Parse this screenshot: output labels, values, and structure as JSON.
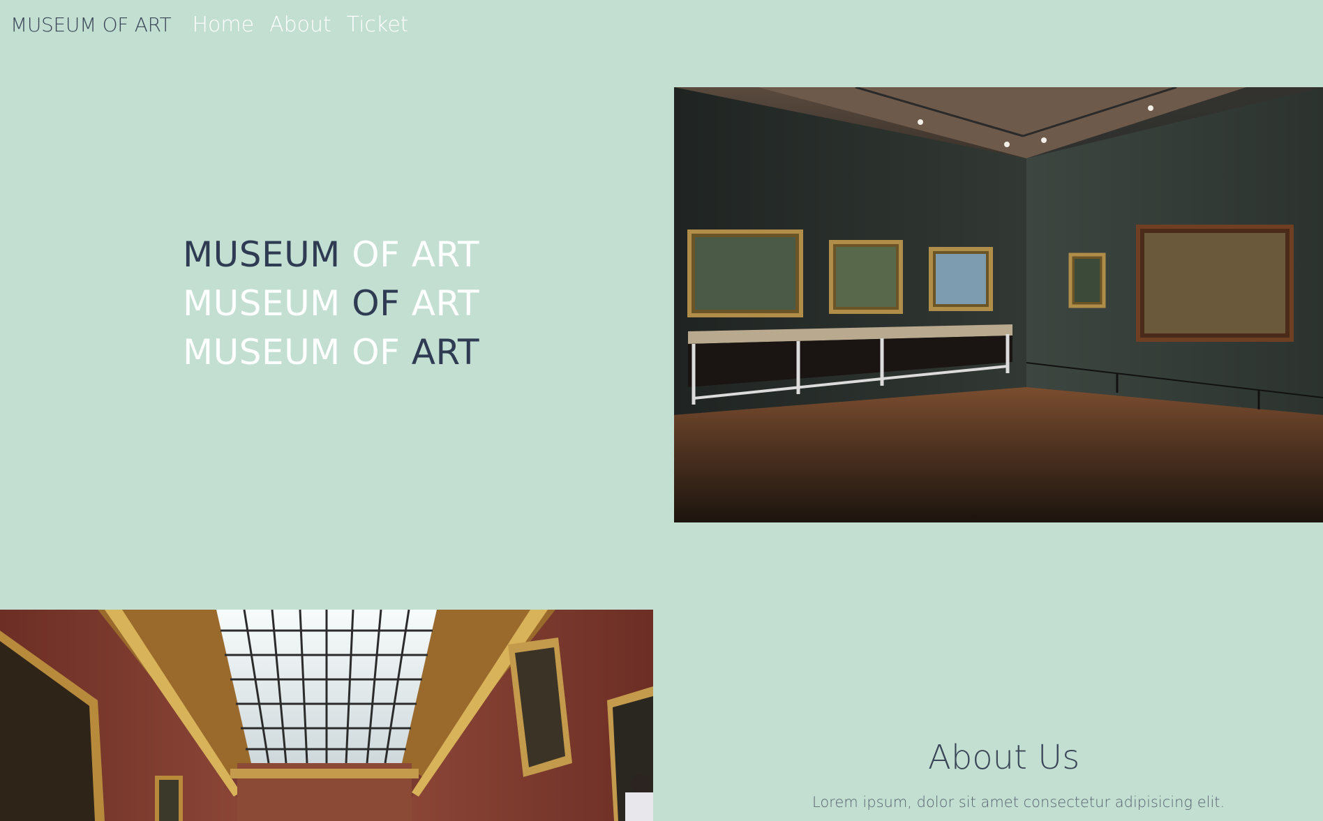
{
  "header": {
    "brand": "MUSEUM OF ART",
    "nav": [
      {
        "label": "Home"
      },
      {
        "label": "About"
      },
      {
        "label": "Ticket"
      }
    ]
  },
  "hero": {
    "lines": [
      {
        "part1": "MUSEUM",
        "part2": "OF",
        "part3": "ART"
      },
      {
        "part1": "MUSEUM",
        "part2": "OF",
        "part3": "ART"
      },
      {
        "part1": "MUSEUM",
        "part2": "OF",
        "part3": "ART"
      }
    ]
  },
  "about": {
    "heading": "About Us",
    "text": "Lorem ipsum, dolor sit amet consectetur adipisicing elit."
  },
  "colors": {
    "background": "#c2dfd2",
    "dark_text": "#2f3b52",
    "light_text": "#ffffff"
  }
}
